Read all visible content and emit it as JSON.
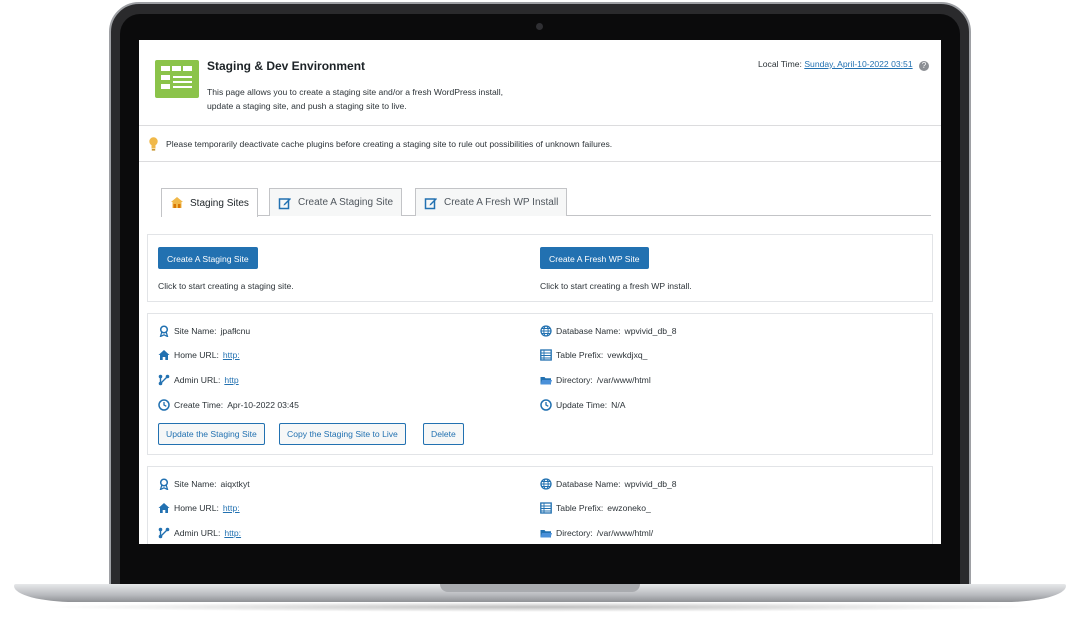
{
  "header": {
    "title": "Staging & Dev Environment",
    "description": "This page allows you to create a staging site and/or a fresh WordPress install, update a staging site, and push a staging site to live.",
    "local_time_label": "Local Time:",
    "local_time_value": "Sunday, April-10-2022 03:51",
    "help_glyph": "?"
  },
  "notice": {
    "text": "Please temporarily deactivate cache plugins before creating a staging site to rule out possibilities of unknown failures."
  },
  "tabs": [
    {
      "label": "Staging Sites",
      "icon": "home-sites-icon",
      "active": true
    },
    {
      "label": "Create A Staging Site",
      "icon": "edit-icon",
      "active": false
    },
    {
      "label": "Create A Fresh WP Install",
      "icon": "edit-icon",
      "active": false
    }
  ],
  "actions": {
    "create_staging_label": "Create A Staging Site",
    "create_staging_hint": "Click to start creating a staging site.",
    "create_fresh_label": "Create A Fresh WP Site",
    "create_fresh_hint": "Click to start creating a fresh WP install."
  },
  "labels": {
    "site_name": "Site Name:",
    "home_url": "Home URL:",
    "admin_url": "Admin URL:",
    "create_time": "Create Time:",
    "database_name": "Database Name:",
    "table_prefix": "Table Prefix:",
    "directory": "Directory:",
    "update_time": "Update Time:"
  },
  "sites": [
    {
      "site_name": "jpafłcnu",
      "home_url": "http:",
      "admin_url": "http",
      "create_time": "Apr-10-2022 03:45",
      "database_name": "wpvivid_db_8",
      "table_prefix": "vewkdjxq_",
      "directory": "/var/www/html",
      "update_time": "N/A",
      "buttons": {
        "update": "Update the Staging Site",
        "copy": "Copy the Staging Site to Live",
        "delete": "Delete"
      }
    },
    {
      "site_name": "aiqxtkyt",
      "home_url": "http:",
      "admin_url": "http:",
      "database_name": "wpvivid_db_8",
      "table_prefix": "ewzoneko_",
      "directory": "/var/www/html/"
    }
  ],
  "colors": {
    "accent": "#2271b1",
    "logo_green": "#8bc34a",
    "bulb": "#f0b849",
    "icon_blue": "#2271b1"
  }
}
